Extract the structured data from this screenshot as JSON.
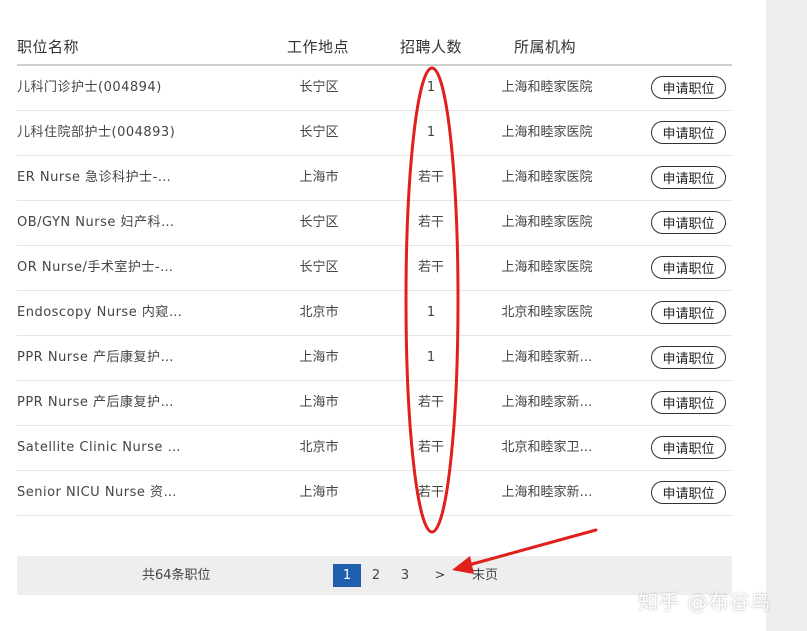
{
  "headers": {
    "name": "职位名称",
    "location": "工作地点",
    "count": "招聘人数",
    "org": "所属机构"
  },
  "apply_label": "申请职位",
  "rows": [
    {
      "name": "儿科门诊护士(004894)",
      "location": "长宁区",
      "count": "1",
      "org": "上海和睦家医院"
    },
    {
      "name": "儿科住院部护士(004893)",
      "location": "长宁区",
      "count": "1",
      "org": "上海和睦家医院"
    },
    {
      "name": "ER Nurse 急诊科护士-…",
      "location": "上海市",
      "count": "若干",
      "org": "上海和睦家医院"
    },
    {
      "name": "OB/GYN Nurse 妇产科…",
      "location": "长宁区",
      "count": "若干",
      "org": "上海和睦家医院"
    },
    {
      "name": "OR Nurse/手术室护士-…",
      "location": "长宁区",
      "count": "若干",
      "org": "上海和睦家医院"
    },
    {
      "name": "Endoscopy Nurse 内窥…",
      "location": "北京市",
      "count": "1",
      "org": "北京和睦家医院"
    },
    {
      "name": "PPR Nurse 产后康复护…",
      "location": "上海市",
      "count": "1",
      "org": "上海和睦家新…"
    },
    {
      "name": "PPR Nurse 产后康复护…",
      "location": "上海市",
      "count": "若干",
      "org": "上海和睦家新…"
    },
    {
      "name": "Satellite Clinic Nurse …",
      "location": "北京市",
      "count": "若干",
      "org": "北京和睦家卫…"
    },
    {
      "name": "Senior NICU Nurse 资…",
      "location": "上海市",
      "count": "若干",
      "org": "上海和睦家新…"
    }
  ],
  "pagination": {
    "total": "共64条职位",
    "pages": [
      "1",
      "2",
      "3"
    ],
    "current": "1",
    "next": ">",
    "last": "末页"
  },
  "watermark": "知乎 @布谷鸟",
  "colors": {
    "accent": "#1f5fad",
    "annotation": "#e0201b",
    "pager_bg": "#eeeeee"
  }
}
